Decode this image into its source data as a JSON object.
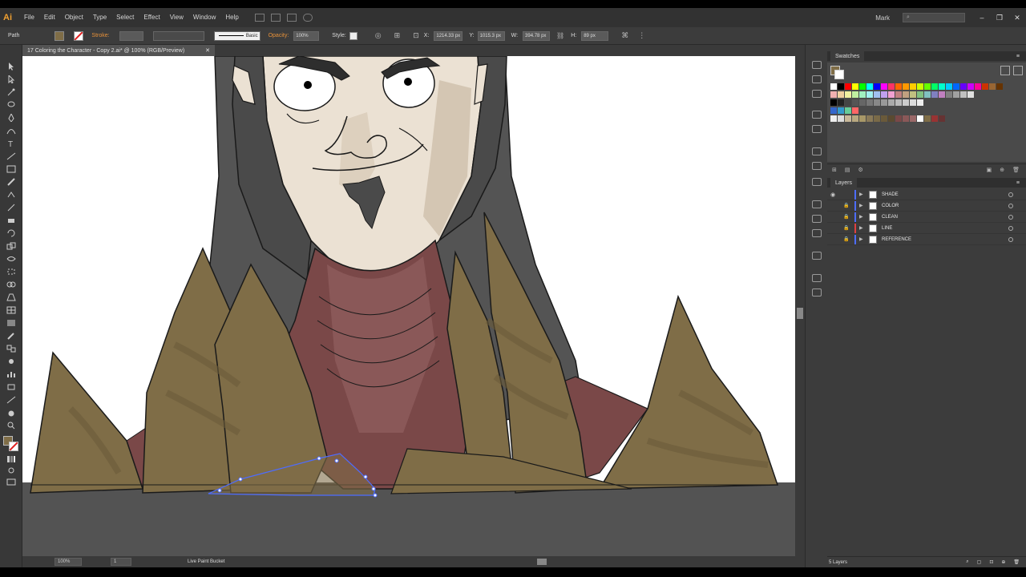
{
  "app": {
    "logo": "Ai",
    "user": "Mark"
  },
  "menu": [
    "File",
    "Edit",
    "Object",
    "Type",
    "Select",
    "Effect",
    "View",
    "Window",
    "Help"
  ],
  "control": {
    "selection": "Path",
    "stroke_label": "Stroke:",
    "brush": "Basic",
    "opacity_label": "Opacity:",
    "opacity": "100%",
    "style_label": "Style:",
    "x_label": "X:",
    "x": "1214.33 px",
    "y_label": "Y:",
    "y": "1015.3 px",
    "w_label": "W:",
    "w": "394.78 px",
    "h_label": "H:",
    "h": "89 px"
  },
  "document": {
    "tab_title": "17 Coloring the Character - Copy 2.ai* @ 100% (RGB/Preview)"
  },
  "status": {
    "zoom": "100%",
    "artboard": "1",
    "tool": "Live Paint Bucket"
  },
  "swatches": {
    "panel_title": "Swatches"
  },
  "layers": {
    "panel_title": "Layers",
    "count": "5 Layers",
    "items": [
      {
        "name": "SHADE",
        "color": "#4d6cff"
      },
      {
        "name": "COLOR",
        "color": "#4d6cff"
      },
      {
        "name": "CLEAN",
        "color": "#4d6cff"
      },
      {
        "name": "LINE",
        "color": "#e04040"
      },
      {
        "name": "REFERENCE",
        "color": "#4d6cff"
      }
    ]
  },
  "colors": {
    "accent": "#e6913a",
    "selection": "#4d6cff"
  }
}
